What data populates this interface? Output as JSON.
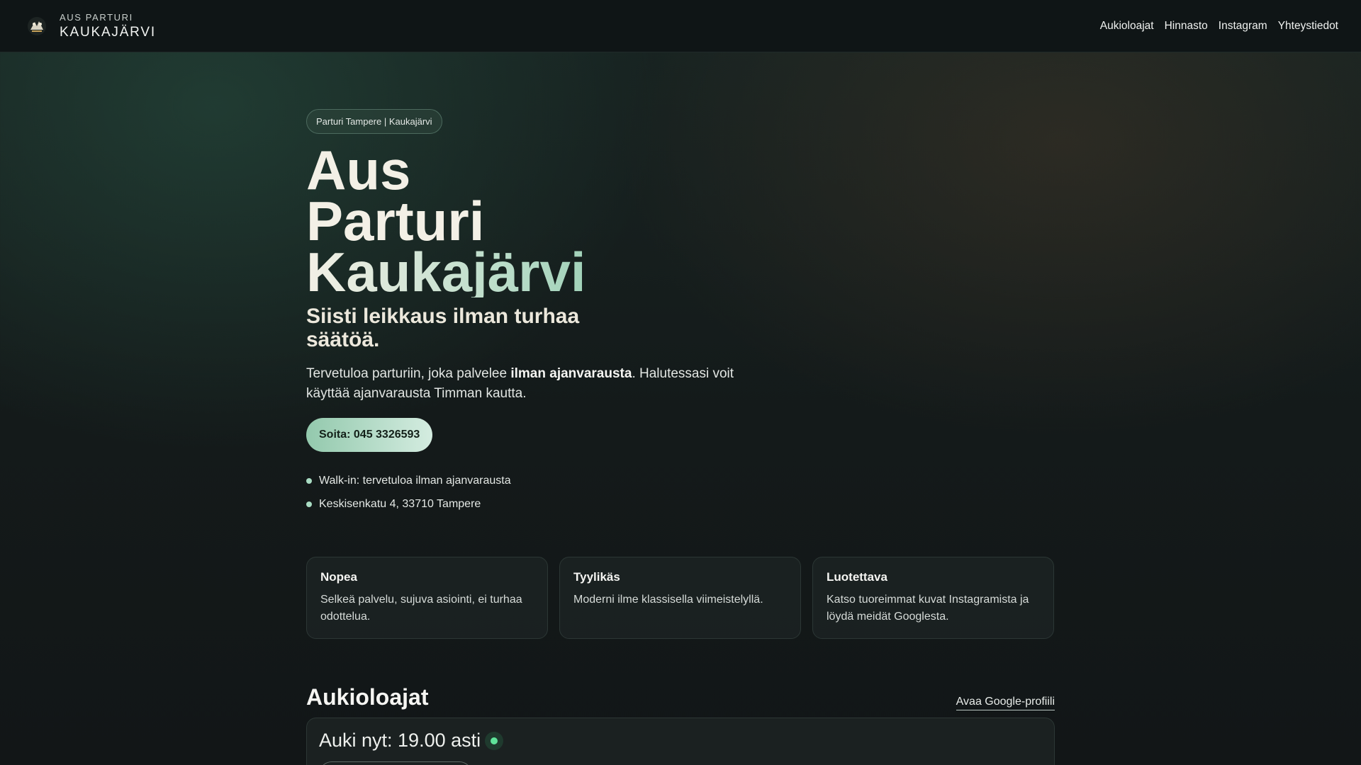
{
  "header": {
    "brand_top": "AUS PARTURI",
    "brand_bottom": "KAUKAJÄRVI",
    "logo_icon": "barber-logo-icon",
    "nav": [
      {
        "label": "Aukioloajat"
      },
      {
        "label": "Hinnasto"
      },
      {
        "label": "Instagram"
      },
      {
        "label": "Yhteystiedot"
      }
    ]
  },
  "hero": {
    "badge": "Parturi Tampere | Kaukajärvi",
    "title_line1": "Aus",
    "title_line2": "Parturi",
    "title_line3": "Kaukajärvi",
    "subtitle": "Siisti leikkaus ilman turhaa säätöä.",
    "intro_before": "Tervetuloa parturiin, joka palvelee ",
    "intro_bold": "ilman ajanvarausta",
    "intro_after": ". Halutessasi voit käyttää ajanvarausta Timman kautta.",
    "call_button": "Soita: 045 3326593",
    "facts": [
      {
        "text": "Walk-in: tervetuloa ilman ajanvarausta"
      },
      {
        "text": "Keskisenkatu 4, 33710 Tampere"
      }
    ]
  },
  "features": [
    {
      "title": "Nopea",
      "text": "Selkeä palvelu, sujuva asiointi, ei turhaa odottelua."
    },
    {
      "title": "Tyylikäs",
      "text": "Moderni ilme klassisella viimeistelyllä."
    },
    {
      "title": "Luotettava",
      "text": "Katso tuoreimmat kuvat Instagramista ja löydä meidät Googlesta."
    }
  ],
  "hours": {
    "title": "Aukioloajat",
    "google_link": "Avaa Google-profiili",
    "status": "Auki nyt: 19.00 asti",
    "status_color": "#5fe39a"
  },
  "colors": {
    "accent_start": "#93c9ad",
    "accent_end": "#d4ece0",
    "background": "#141a1a"
  }
}
